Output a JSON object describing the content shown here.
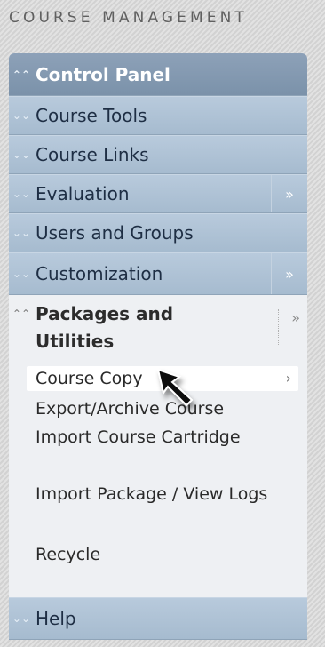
{
  "header": {
    "title": "COURSE MANAGEMENT"
  },
  "menu": {
    "control_panel": "Control Panel",
    "items": [
      {
        "label": "Course Tools",
        "has_action": false
      },
      {
        "label": "Course Links",
        "has_action": false
      },
      {
        "label": "Evaluation",
        "has_action": true
      },
      {
        "label": "Users and Groups",
        "has_action": false
      },
      {
        "label": "Customization",
        "has_action": true
      }
    ],
    "open_section": {
      "title": "Packages and Utilities",
      "subitems": [
        "Course Copy",
        "Export/Archive Course",
        "Import Course Cartridge",
        "Import Package / View Logs",
        "Recycle"
      ]
    },
    "help": "Help"
  },
  "icons": {
    "collapse": "double-chevron-up-icon",
    "expand": "double-chevron-down-icon",
    "action": "double-chevron-right-icon",
    "submenu": "chevron-right-icon",
    "cursor": "mouse-pointer-icon"
  },
  "colors": {
    "control_panel_bg": "#7b92aa",
    "row_bg": "#a6bbcf",
    "section_bg": "#eef0f3",
    "text_dark": "#1e2e44"
  }
}
